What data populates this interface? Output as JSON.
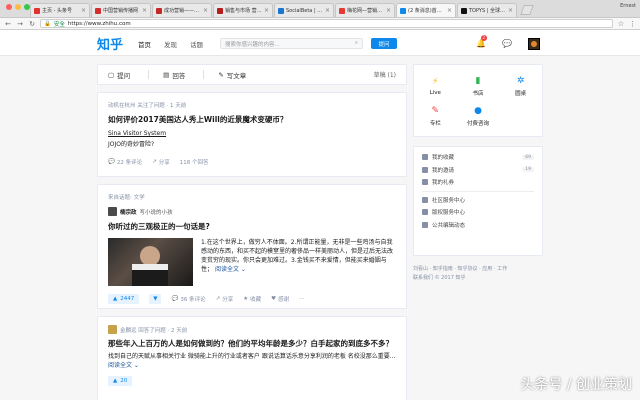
{
  "browser": {
    "tabs": [
      {
        "label": "主页 - 头条号",
        "color": "#e2322d"
      },
      {
        "label": "中国营销传播网",
        "color": "#d32f2f"
      },
      {
        "label": "成功营销——中国",
        "color": "#c62828"
      },
      {
        "label": "销售与市场 营一营",
        "color": "#b71c1c"
      },
      {
        "label": "SocialBeta | 领先",
        "color": "#1976d2"
      },
      {
        "label": "梅花网—营销者的",
        "color": "#e53935"
      },
      {
        "label": "(2 条消息)首页 - 知乎",
        "color": "#0f88eb",
        "active": true
      },
      {
        "label": "TOPYS | 全球顶尖",
        "color": "#111111"
      }
    ],
    "user_chip": "Ernest",
    "secure_label": "安全",
    "url": "https://www.zhihu.com"
  },
  "header": {
    "logo": "知乎",
    "nav": [
      "首页",
      "发现",
      "话题"
    ],
    "search_placeholder": "搜索你感兴趣的内容...",
    "ask_label": "提问",
    "notification_count": "2"
  },
  "write_bar": {
    "ask": "提问",
    "answer": "回答",
    "write": "写文章",
    "drafts": "草稿 (1)"
  },
  "feed": [
    {
      "meta": "动机在杭州 关注了问题 · 1 天前",
      "title": "如何评价2017美国达人秀上Will的近景魔术变硬币？",
      "author": "Sina Visitor System",
      "author_sub": "JOJO的奇妙冒险?",
      "actions": [
        "22 条评论",
        "分享",
        "118 个回答"
      ]
    },
    {
      "meta": "来自话题: 文学",
      "author_name": "楠宗政",
      "author_bio": "写小说的小孩",
      "title": "你听过的三观极正的一句话是?",
      "excerpt": "1.在这个世界上，做穷人不体面。2.所谓正能量，无非是一些鸡汤与自我感动的东西，和买不起的模窒里的奢侈品一样美丽动人，但是过后无法改变贫穷的现实。你只会更加难过。3.金钱买不来爱情，但能买来婚姻与性；",
      "read_more": "阅读全文 ⌄",
      "votes": "2447",
      "actions": [
        "36 条评论",
        "分享",
        "收藏",
        "感谢",
        "···"
      ]
    },
    {
      "meta": "金麟远 回答了问题 · 2 天前",
      "author_name": "金麟远",
      "title": "那些年入上百万的人是如何做到的？他们的平均年龄是多少？白手起家的到底多不多？",
      "excerpt": "找到自己的天赋从事相关行业 微骑能上升的行业或者客户 跟说话算话乐意分享利润的老板 名校没那么重要...",
      "read_more": "阅读全文 ⌄",
      "votes": "20"
    }
  ],
  "sidebar_top": [
    {
      "label": "Live",
      "icon": "lightning-icon",
      "color": "#f7b500"
    },
    {
      "label": "书店",
      "icon": "book-icon",
      "color": "#2fb553"
    },
    {
      "label": "圆桌",
      "icon": "roundtable-icon",
      "color": "#0f88eb"
    },
    {
      "label": "专栏",
      "icon": "pen-icon",
      "color": "#f1403c"
    },
    {
      "label": "付费咨询",
      "icon": "consult-icon",
      "color": "#0f88eb"
    }
  ],
  "sidebar_list": [
    {
      "label": "我的收藏",
      "count": "69"
    },
    {
      "label": "我的邀请",
      "count": "19"
    },
    {
      "label": "我的礼券",
      "count": ""
    },
    {
      "label": "社区服务中心",
      "count": ""
    },
    {
      "label": "版权服务中心",
      "count": ""
    },
    {
      "label": "公共编辑动态",
      "count": ""
    }
  ],
  "footer": {
    "line1": "刘看山 · 知乎指南 · 知乎协议 · 应用 · 工作",
    "line2": "联系我们 © 2017 知乎"
  },
  "watermark": "头条号 / 创业策划"
}
